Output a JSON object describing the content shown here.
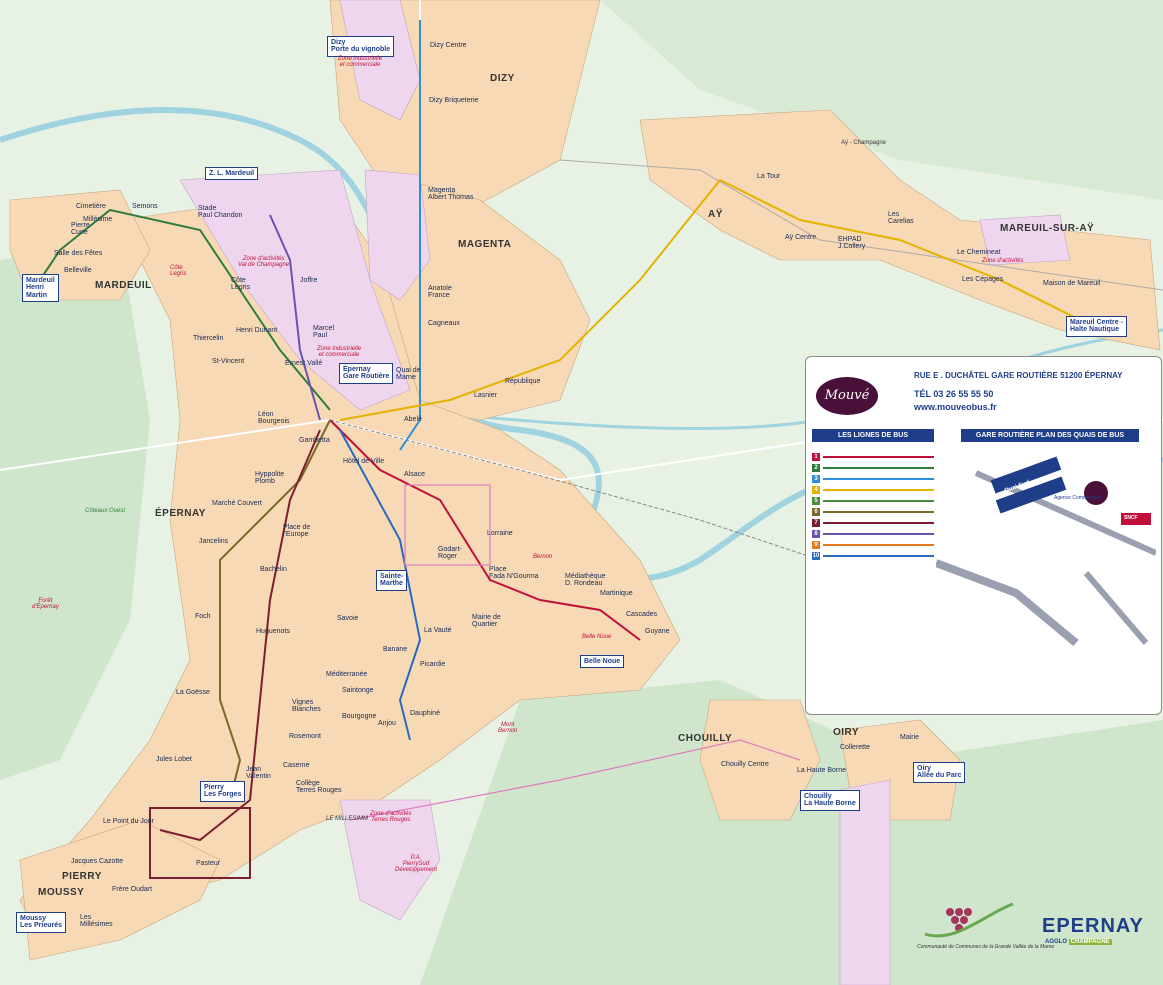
{
  "colors": {
    "urban": "#f7d9b5",
    "zone_activity": "#eed7ee",
    "forest": "#cfe6cc",
    "river": "#9fd3e0",
    "brand": "#1f3e8a",
    "line1": "#c0103a",
    "line2": "#2f7d3c",
    "line3": "#2e8fd8",
    "line4": "#e6b200",
    "line5": "#4b8c3a",
    "line6": "#7a6a2a",
    "line7": "#7a1f2f",
    "line8": "#6a53b0",
    "line9": "#e47b1f",
    "line10": "#2a6abf"
  },
  "towns": [
    "DIZY",
    "MAGENTA",
    "AŸ",
    "MAREUIL-SUR-AŸ",
    "MARDEUIL",
    "ÉPERNAY",
    "CHOUILLY",
    "OIRY",
    "PIERRY",
    "MOUSSY"
  ],
  "terminals": {
    "dizy": "Dizy\nPorte du vignoble",
    "zl_mardeuil": "Z. L. Mardeuil",
    "mardeuil": "Mardeuil\nHenri\nMartin",
    "gare": "Épernay\nGare Routière",
    "sainte_marthe": "Sainte-\nMarthe",
    "belle_noue": "Belle Noue",
    "pierry": "Pierry\nLes Forges",
    "moussy": "Moussy\nLes Prieurés",
    "chouilly": "Chouilly\nLa Haute Borne",
    "oiry": "Oiry\nAllée du Parc",
    "mareuil": "Mareuil Centre -\nHalte Nautique"
  },
  "stops": [
    "Dizy Centre",
    "Dizy Briqueterie",
    "Magenta\nAlbert Thomas",
    "Anatole\nFrance",
    "Cagneaux",
    "République",
    "Lasnier",
    "Quai de\nMarne",
    "Abelé",
    "Stade\nPaul Chandon",
    "Semons",
    "Cimetière",
    "Millésime",
    "Pierre\nCurie",
    "Salle des Fêtes",
    "Belleville",
    "Côte\nLegris",
    "Joffre",
    "Henri Dunant",
    "Marcel\nPaul",
    "Thiercelin",
    "St-Vincent",
    "Ernest Vallé",
    "Léon\nBourgeois",
    "Gambetta",
    "Hôtel de Ville",
    "Alsace",
    "Lorraine",
    "Godart-\nRoger",
    "Place\nFada N'Gourma",
    "Médiathèque\nD. Rondeau",
    "Martinique",
    "Cascades",
    "Guyane",
    "Marché Couvert",
    "Hyppolite\nPlomb",
    "Place de\nl'Europe",
    "Jancelins",
    "Bachelin",
    "Foch",
    "Huguenots",
    "Savoie",
    "La Vauté",
    "Mairie de\nQuartier",
    "Banane",
    "Picardie",
    "La Goësse",
    "Méditerranée",
    "Saintonge",
    "Vignes\nBlanches",
    "Rosemont",
    "Bourgogne",
    "Anjou",
    "Dauphiné",
    "Jules Lobet",
    "Jean\nValentin",
    "Caserne",
    "Collège\nTerres Rouges",
    "Le Point du Jour",
    "Jacques Cazotte",
    "Pasteur",
    "Frère Oudart",
    "Les\nMillésimes",
    "La Tour",
    "Aÿ Centre",
    "EHPAD\nJ.Collery",
    "Les\nCarelias",
    "Le Chemineat",
    "Les Cépages",
    "Maison de Mareuil",
    "Chouilly Centre",
    "La Haute Borne",
    "Collerette",
    "Mairie"
  ],
  "zones": [
    "Zone industrielle\net commerciale",
    "Zone d'activités\nVal de Champagne",
    "Zone industrielle\net commerciale",
    "Zone d'activités",
    "Zone d'activités\nTerres Rouges",
    "P.A.\nPierrySud\nDéveloppement"
  ],
  "places": [
    "Côte\nLegris",
    "Côteaux Ouest",
    "Forêt\nd'Épernay",
    "Mont\nBernon",
    "Bernon",
    "Belle Noue",
    "Aÿ - Champagne",
    "LE MILLESIMM"
  ],
  "panel": {
    "brand": "Mouvé",
    "address": "RUE E . DUCHÂTEL GARE ROUTIÈRE  51200 ÉPERNAY",
    "tel": "TÉL  03 26 55 55 50",
    "web": "www.mouveobus.fr",
    "lines_header": "LES LIGNES DE BUS",
    "quais_header_1": "GARE ROUTIÈRE",
    "quais_header_2": "PLAN DES QUAIS DE BUS",
    "quai_nord": "Quai Nord",
    "quai_sud": "Quai Sud",
    "agence": "Agence Commerciale",
    "sncf": "SNCF"
  },
  "logos": {
    "epernay": "EPERNAY",
    "agglo": "AGGLO",
    "champagne": "CHAMPAGNE",
    "communaute": "Communauté de Communes de la Grande Vallée de la Marne"
  }
}
